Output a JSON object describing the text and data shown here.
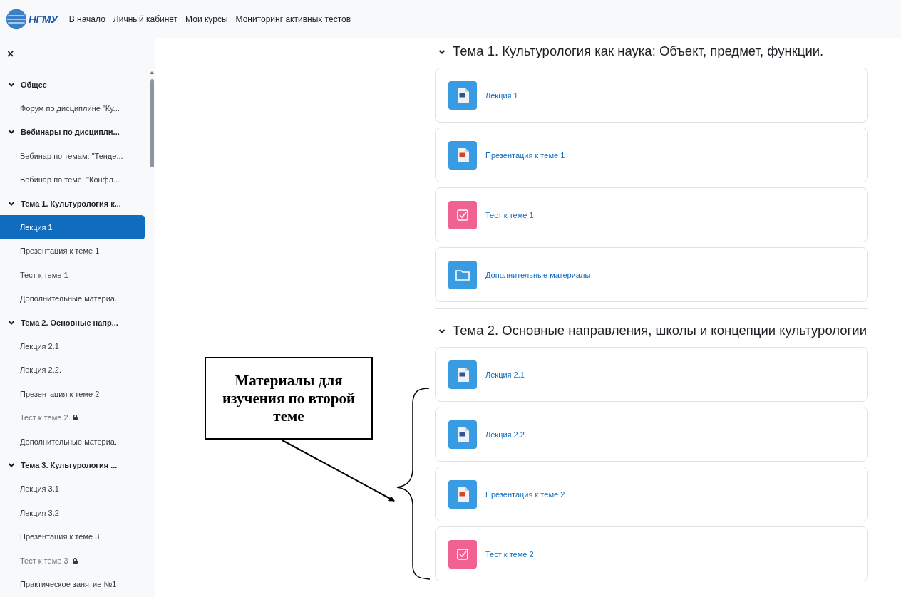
{
  "header": {
    "logo_text": "НГМУ",
    "nav": [
      {
        "label": "В начало"
      },
      {
        "label": "Личный кабинет"
      },
      {
        "label": "Мои курсы"
      },
      {
        "label": "Мониторинг активных тестов"
      }
    ]
  },
  "course_index": {
    "close": "×",
    "sections": [
      {
        "title": "Общее",
        "expanded": true,
        "children": [
          {
            "label": "Форум по дисциплине \"Ку...",
            "selected": false,
            "locked": false
          }
        ]
      },
      {
        "title": "Вебинары по дисципли...",
        "expanded": true,
        "children": [
          {
            "label": "Вебинар по темам: \"Тенде...",
            "selected": false,
            "locked": false
          },
          {
            "label": "Вебинар по теме: \"Конфл...",
            "selected": false,
            "locked": false
          }
        ]
      },
      {
        "title": "Тема 1. Культурология к...",
        "expanded": true,
        "children": [
          {
            "label": "Лекция 1",
            "selected": true,
            "locked": false
          },
          {
            "label": "Презентация к теме 1",
            "selected": false,
            "locked": false
          },
          {
            "label": "Тест к теме 1",
            "selected": false,
            "locked": false
          },
          {
            "label": "Дополнительные материа...",
            "selected": false,
            "locked": false
          }
        ]
      },
      {
        "title": "Тема 2. Основные напр...",
        "expanded": true,
        "children": [
          {
            "label": "Лекция 2.1",
            "selected": false,
            "locked": false
          },
          {
            "label": "Лекция 2.2.",
            "selected": false,
            "locked": false
          },
          {
            "label": "Презентация к теме 2",
            "selected": false,
            "locked": false
          },
          {
            "label": "Тест к теме 2",
            "selected": false,
            "locked": true
          },
          {
            "label": "Дополнительные материа...",
            "selected": false,
            "locked": false
          }
        ]
      },
      {
        "title": "Тема 3. Культурология ...",
        "expanded": true,
        "children": [
          {
            "label": "Лекция 3.1",
            "selected": false,
            "locked": false
          },
          {
            "label": "Лекция 3.2",
            "selected": false,
            "locked": false
          },
          {
            "label": "Презентация к теме 3",
            "selected": false,
            "locked": false
          },
          {
            "label": "Тест к теме 3",
            "selected": false,
            "locked": true
          },
          {
            "label": "Практическое занятие №1",
            "selected": false,
            "locked": false
          }
        ]
      }
    ]
  },
  "sections": [
    {
      "title": "Тема 1. Культурология как наука: Объект, предмет, функции.",
      "expanded": true,
      "activities": [
        {
          "kind": "word",
          "label": "Лекция 1"
        },
        {
          "kind": "slides",
          "label": "Презентация к теме 1"
        },
        {
          "kind": "quiz",
          "label": "Тест к теме 1"
        },
        {
          "kind": "folder",
          "label": "Дополнительные материалы"
        }
      ]
    },
    {
      "title": "Тема 2. Основные направления, школы и концепции культурологии",
      "expanded": true,
      "activities": [
        {
          "kind": "word",
          "label": "Лекция 2.1"
        },
        {
          "kind": "word",
          "label": "Лекция 2.2."
        },
        {
          "kind": "slides",
          "label": "Презентация к теме 2"
        },
        {
          "kind": "quiz",
          "label": "Тест к теме 2"
        }
      ]
    }
  ],
  "annotation": {
    "text": "Материалы для изучения по второй теме"
  }
}
